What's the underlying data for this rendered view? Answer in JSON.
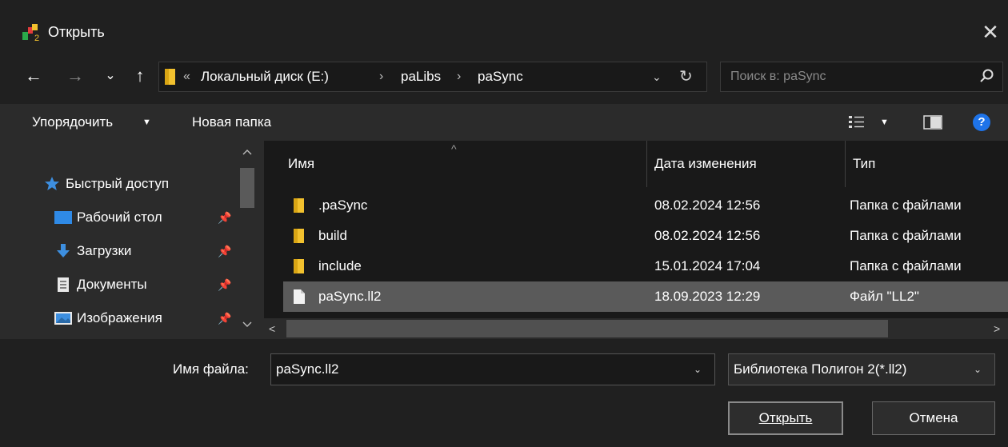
{
  "window": {
    "title": "Открыть",
    "close_glyph": "✕"
  },
  "nav": {
    "back_glyph": "←",
    "forward_glyph": "→",
    "recent_glyph": "⌄",
    "up_glyph": "↑"
  },
  "address": {
    "overflow_glyph": "«",
    "separator_glyph": "›",
    "crumbs": [
      "Локальный диск (E:)",
      "paLibs",
      "paSync"
    ],
    "dropdown_glyph": "⌄",
    "refresh_glyph": "↻"
  },
  "search": {
    "placeholder": "Поиск в: paSync"
  },
  "toolbar": {
    "organize_label": "Упорядочить",
    "organize_caret": "▼",
    "new_folder_label": "Новая папка",
    "view_caret": "▼",
    "help_label": "?"
  },
  "sidebar": {
    "items": [
      {
        "label": "Быстрый доступ",
        "icon": "star-icon",
        "pinned": false
      },
      {
        "label": "Рабочий стол",
        "icon": "desktop-icon",
        "pinned": true
      },
      {
        "label": "Загрузки",
        "icon": "download-icon",
        "pinned": true
      },
      {
        "label": "Документы",
        "icon": "document-icon",
        "pinned": true
      },
      {
        "label": "Изображения",
        "icon": "image-icon",
        "pinned": true
      }
    ],
    "pin_glyph": "📌"
  },
  "filelist": {
    "columns": [
      "Имя",
      "Дата изменения",
      "Тип"
    ],
    "sort_glyph": "^",
    "rows": [
      {
        "name": ".paSync",
        "date": "08.02.2024 12:56",
        "type": "Папка с файлами",
        "kind": "folder",
        "selected": false
      },
      {
        "name": "build",
        "date": "08.02.2024 12:56",
        "type": "Папка с файлами",
        "kind": "folder",
        "selected": false
      },
      {
        "name": "include",
        "date": "15.01.2024 17:04",
        "type": "Папка с файлами",
        "kind": "folder",
        "selected": false
      },
      {
        "name": "paSync.ll2",
        "date": "18.09.2023 12:29",
        "type": "Файл \"LL2\"",
        "kind": "file",
        "selected": true
      }
    ]
  },
  "hscroll": {
    "left_glyph": "<",
    "right_glyph": ">"
  },
  "bottom": {
    "filename_label": "Имя файла:",
    "filename_value": "paSync.ll2",
    "filetype_value": "Библиотека Полигон 2(*.ll2)",
    "caret_glyph": "⌄",
    "open_label": "Открыть",
    "cancel_label": "Отмена"
  },
  "colors": {
    "background": "#202020",
    "panel": "#2b2b2b",
    "list": "#191919",
    "selection": "#5a5a5a",
    "folder": "#f2c12e",
    "accent": "#1e73e8"
  }
}
